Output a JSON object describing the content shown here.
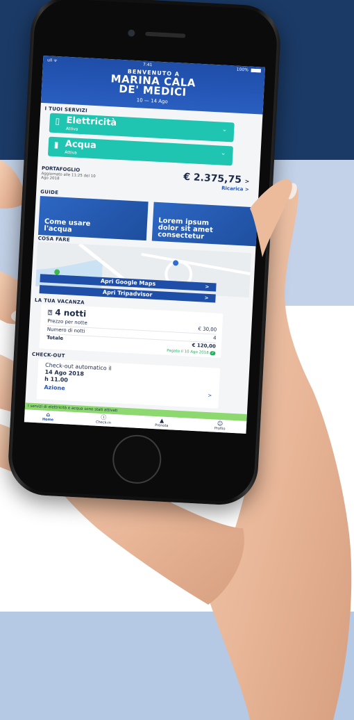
{
  "status_bar": {
    "carrier": "ull ᯤ",
    "time": "7:41",
    "battery": "100%"
  },
  "header": {
    "welcome": "BENVENUTO A",
    "title_line1": "MARINA CALA",
    "title_line2": "DE' MEDICI",
    "dates": "10 — 14 Ago"
  },
  "services": {
    "label": "I TUOI SERVIZI",
    "items": [
      {
        "name": "Elettricità",
        "status": "Attiva",
        "icon": "plug-icon"
      },
      {
        "name": "Acqua",
        "status": "Attiva",
        "icon": "bookmark-icon"
      }
    ]
  },
  "wallet": {
    "title": "PORTAFOGLIO",
    "updated": "Aggiornato alle 11:25 del 10 Ago 2018",
    "amount": "€ 2.375,75",
    "amount_arrow": ">",
    "recharge": "Ricarica >"
  },
  "guides": {
    "label": "GUIDE",
    "items": [
      "Come usare l'acqua",
      "Lorem ipsum dolor sit amet consectetur"
    ]
  },
  "things_to_do": {
    "label": "COSA FARE",
    "google_maps": "Apri Google Maps",
    "tripadvisor": "Apri Tripadvisor",
    "arrow": ">"
  },
  "vacation": {
    "label": "LA TUA VACANZA",
    "nights": "4 notti",
    "rows": [
      {
        "label": "Prezzo per notte",
        "value": "€ 30,00"
      },
      {
        "label": "Numero di notti",
        "value": "4"
      },
      {
        "label": "Totale",
        "value": "€ 120,00"
      }
    ],
    "paid": "Pagato il 10 Ago 2018"
  },
  "checkout": {
    "label": "CHECK-OUT",
    "text": "Check-out automatico il",
    "date": "14 Ago 2018",
    "time": "h 11.00",
    "action": "Azione",
    "arrow": ">"
  },
  "banner": "I servizi di elettricità e acqua sono stati attivati",
  "tabs": [
    {
      "label": "Home",
      "icon": "home-icon"
    },
    {
      "label": "Check-in",
      "icon": "info-icon"
    },
    {
      "label": "Prenota",
      "icon": "boat-icon"
    },
    {
      "label": "Profilo",
      "icon": "profile-icon"
    }
  ],
  "colors": {
    "navy_background": "#1b3a66",
    "light_blue_background": "#c3d2e8",
    "header_blue": "#1f4ea8",
    "service_teal": "#20c5b2",
    "banner_green": "#8ed870",
    "link_blue": "#2555b5"
  }
}
